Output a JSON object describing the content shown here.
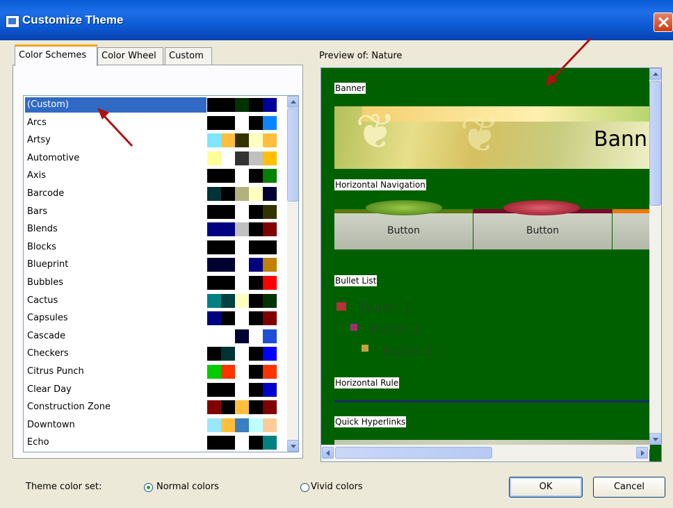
{
  "window": {
    "title": "Customize Theme"
  },
  "tabs": [
    {
      "label": "Color Schemes"
    },
    {
      "label": "Color Wheel"
    },
    {
      "label": "Custom"
    }
  ],
  "schemes": [
    {
      "name": "(Custom)",
      "colors": [
        "#000000",
        "#003300",
        "#000000",
        "#000099"
      ]
    },
    {
      "name": "Arcs",
      "colors": [
        "#000000",
        "#ffffff",
        "#000000",
        "#0a84ff"
      ]
    },
    {
      "name": "Artsy",
      "colors": [
        "#7ce7ff",
        "#ffbf3c",
        "#333300",
        "#ffffc0",
        "#ffbf3c"
      ]
    },
    {
      "name": "Automotive",
      "colors": [
        "#ffff99",
        "#ffffff",
        "#333333",
        "#c0c0c0",
        "#ffbf00"
      ]
    },
    {
      "name": "Axis",
      "colors": [
        "#000000",
        "#ffffff",
        "#000000",
        "#008000"
      ]
    },
    {
      "name": "Barcode",
      "colors": [
        "#003333",
        "#000000",
        "#b2b280",
        "#ffffc0",
        "#000033"
      ]
    },
    {
      "name": "Bars",
      "colors": [
        "#000000",
        "#ffffff",
        "#000000",
        "#333300"
      ]
    },
    {
      "name": "Blends",
      "colors": [
        "#000080",
        "#c0c0c0",
        "#000000",
        "#800000"
      ]
    },
    {
      "name": "Blocks",
      "colors": [
        "#000000",
        "#ffffff",
        "#000000",
        "#000000"
      ]
    },
    {
      "name": "Blueprint",
      "colors": [
        "#000033",
        "#ffffff",
        "#000080",
        "#c08000"
      ]
    },
    {
      "name": "Bubbles",
      "colors": [
        "#000000",
        "#ffffff",
        "#000000",
        "#ff0000"
      ]
    },
    {
      "name": "Cactus",
      "colors": [
        "#008080",
        "#004040",
        "#ffffc0",
        "#000000",
        "#003300"
      ]
    },
    {
      "name": "Capsules",
      "colors": [
        "#000080",
        "#000000",
        "#ffffff",
        "#000000",
        "#800000"
      ]
    },
    {
      "name": "Cascade",
      "colors": [
        "#ffffff",
        "#ffffff",
        "#000033",
        "#ffffff",
        "#1c4ed8"
      ]
    },
    {
      "name": "Checkers",
      "colors": [
        "#000000",
        "#003333",
        "#ffffff",
        "#000000",
        "#0000ff"
      ]
    },
    {
      "name": "Citrus Punch",
      "colors": [
        "#00cc00",
        "#ff3300",
        "#ffffff",
        "#000000",
        "#ff3300"
      ]
    },
    {
      "name": "Clear Day",
      "colors": [
        "#000000",
        "#ffffff",
        "#000000",
        "#0000cc"
      ]
    },
    {
      "name": "Construction Zone",
      "colors": [
        "#800000",
        "#000000",
        "#ffbf3c",
        "#000000",
        "#800000"
      ]
    },
    {
      "name": "Downtown",
      "colors": [
        "#99e7ff",
        "#ffbf3c",
        "#3a80c0",
        "#c0ffff",
        "#ffcc99"
      ]
    },
    {
      "name": "Echo",
      "colors": [
        "#000000",
        "#ffffff",
        "#000000",
        "#008080"
      ]
    }
  ],
  "preview": {
    "label": "Preview of: Nature",
    "banner_label": "Banner",
    "banner_text": "Bann",
    "nav_label": "Horizontal Navigation",
    "nav_buttons": [
      "Button",
      "Button"
    ],
    "bullet_label": "Bullet List",
    "bullets": [
      "Bullet 1",
      "Bullet 2",
      "Bullet 3"
    ],
    "rule_label": "Horizontal Rule",
    "quick_label": "Quick Hyperlinks"
  },
  "footer": {
    "color_set_label": "Theme color set:",
    "normal_label": "Normal colors",
    "vivid_label": "Vivid colors",
    "normal_selected": true,
    "ok_label": "OK",
    "cancel_label": "Cancel"
  },
  "colors": {
    "accent": "#316ac5",
    "titlebar": "#0a5bd6",
    "preview_bg": "#006000",
    "annotation_arrow": "#b01010"
  }
}
